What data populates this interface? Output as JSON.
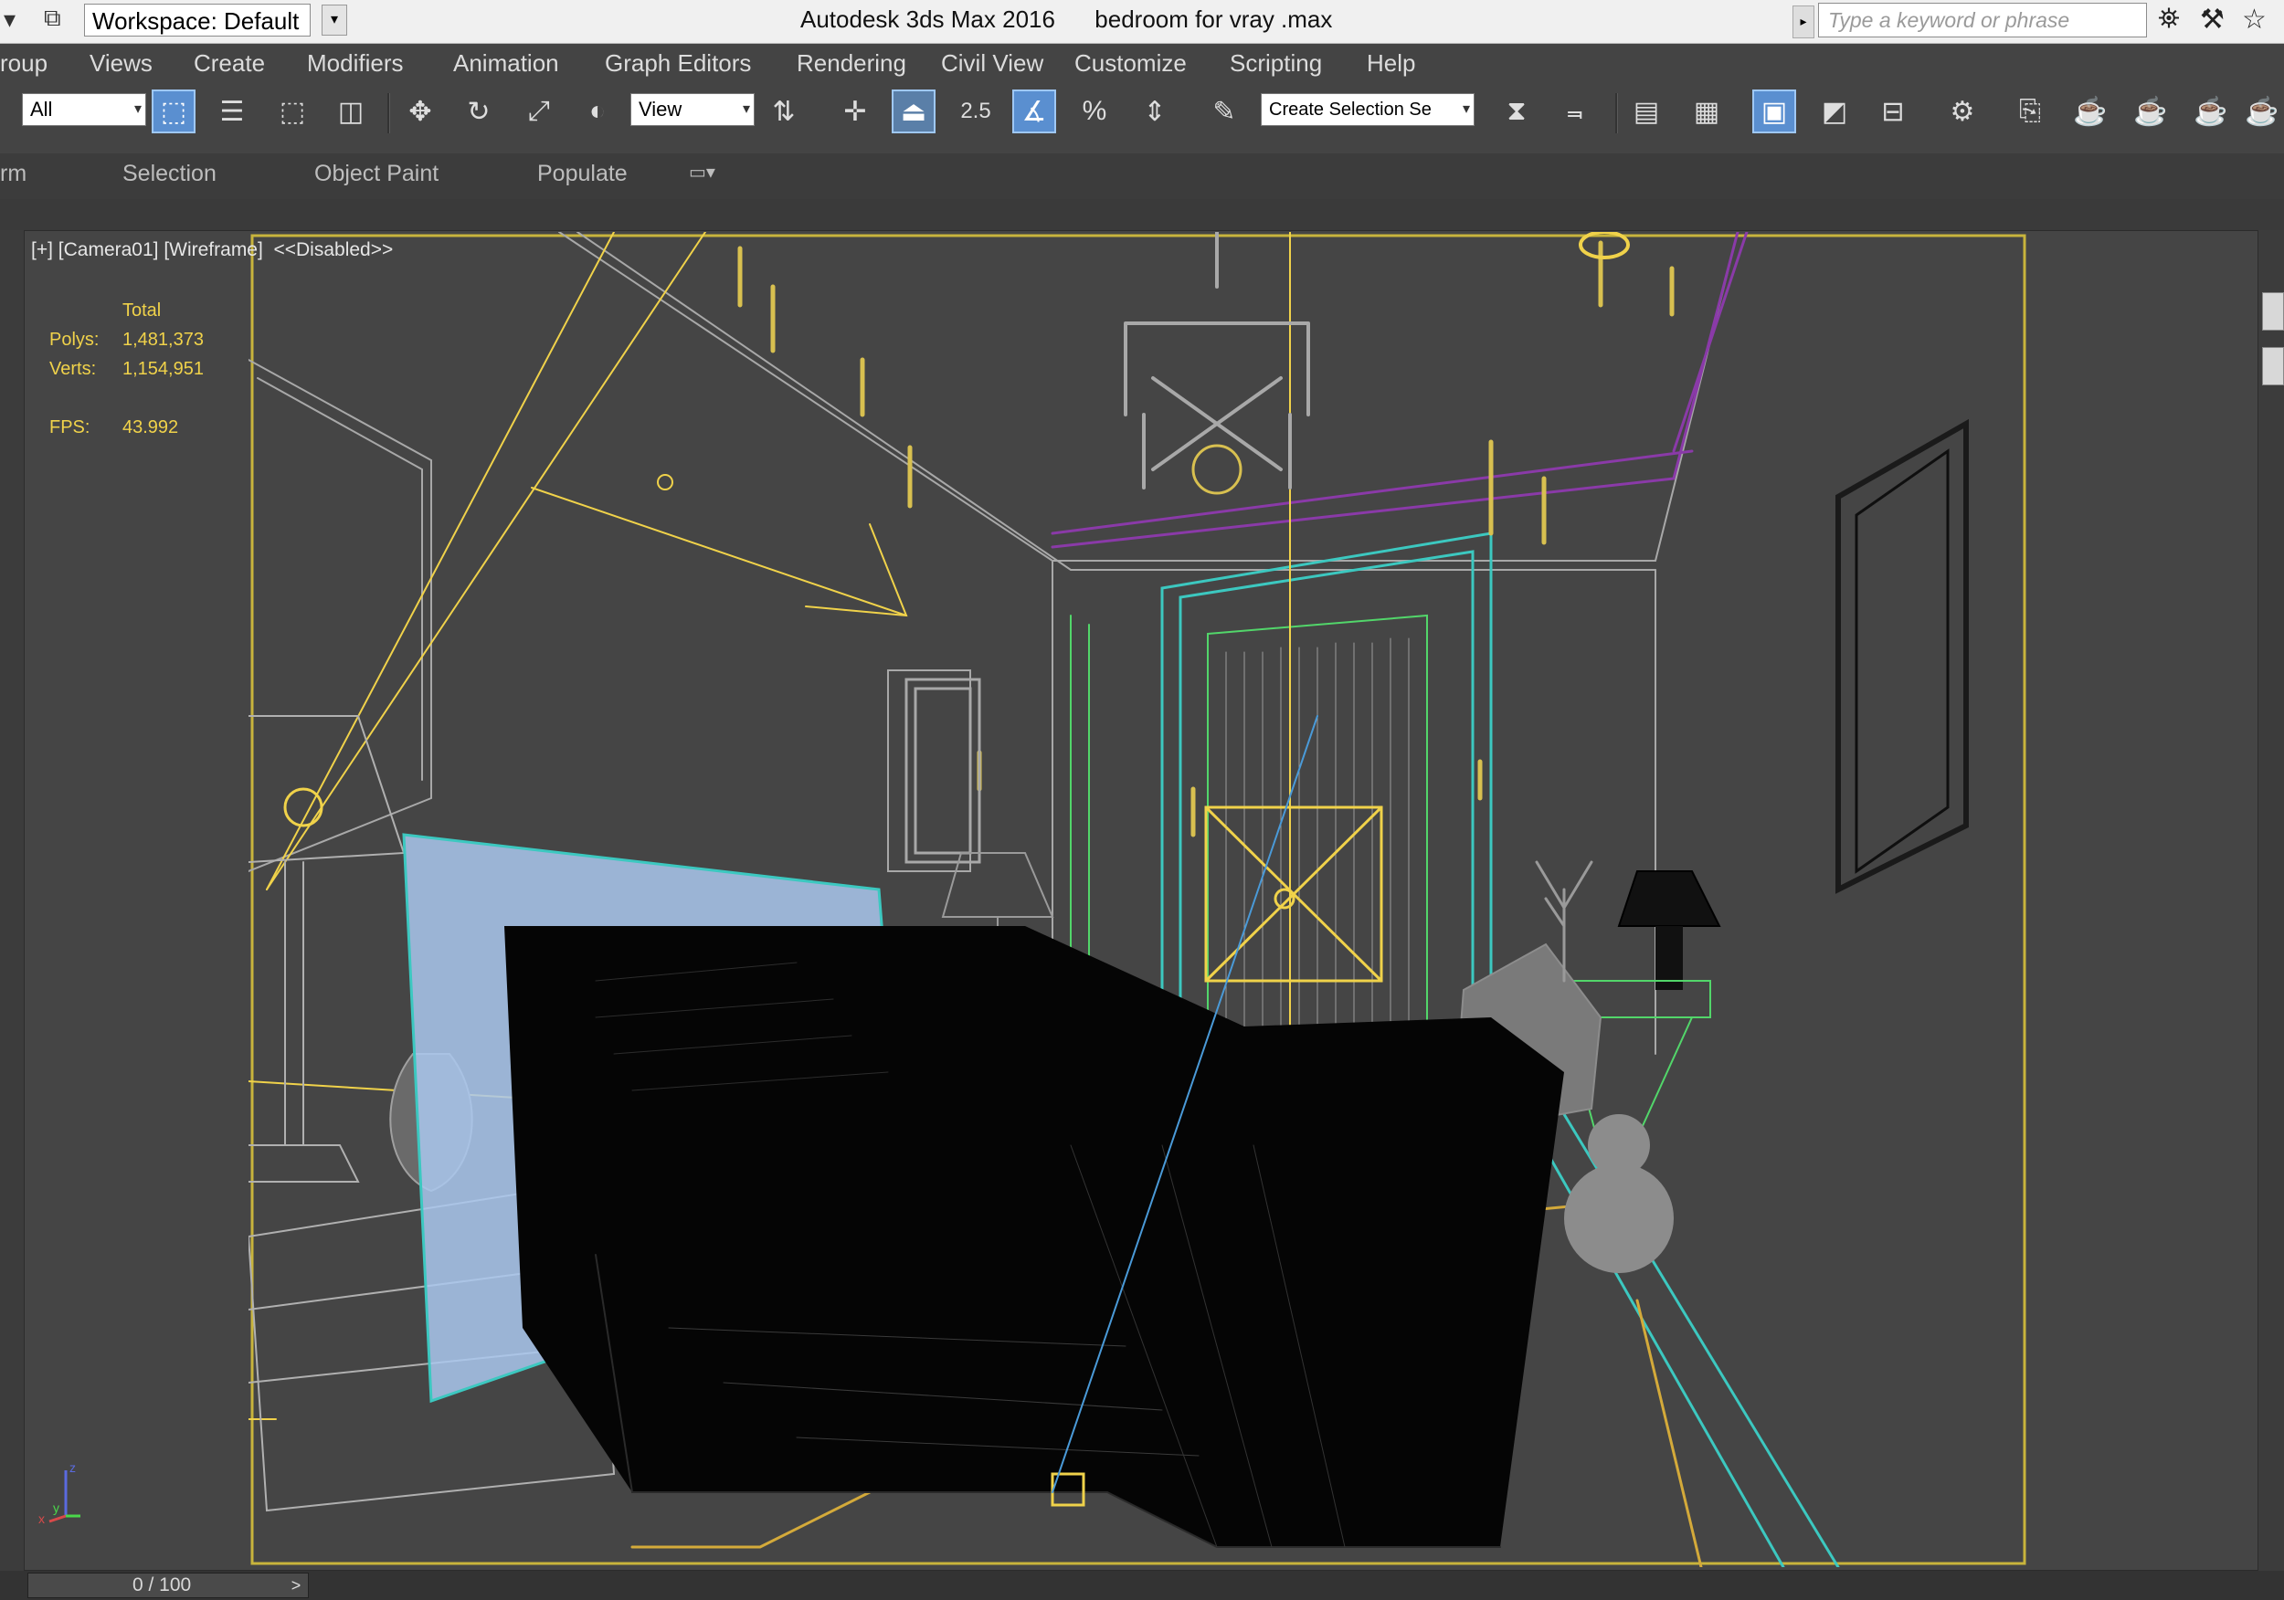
{
  "window": {
    "title": "Autodesk 3ds Max 2016      bedroom for vray .max",
    "workspace": "Workspace: Default",
    "search_placeholder": "Type a keyword or phrase"
  },
  "menu": [
    "roup",
    "Views",
    "Create",
    "Modifiers",
    "Animation",
    "Graph Editors",
    "Rendering",
    "Civil View",
    "Customize",
    "Scripting",
    "Help"
  ],
  "toolbar": {
    "selection_filter": "All",
    "reference_coord": "View",
    "snap_angle": "2.5",
    "named_selection": "Create Selection Se"
  },
  "ribbon": [
    "rm",
    "Selection",
    "Object Paint",
    "Populate"
  ],
  "viewport": {
    "label": "[+] [Camera01] [Wireframe]  <<Disabled>>",
    "stats": {
      "header": "Total",
      "polys_label": "Polys:",
      "polys_value": "1,481,373",
      "verts_label": "Verts:",
      "verts_value": "1,154,951",
      "fps_label": "FPS:",
      "fps_value": "43.992"
    }
  },
  "timeline": {
    "frame": "0 / 100"
  },
  "icons": [
    "system-menu-icon",
    "quick-access-icon",
    "binoculars-icon",
    "tools-icon",
    "star-icon",
    "select-object-icon",
    "select-by-name-icon",
    "rect-region-icon",
    "window-crossing-icon",
    "move-icon",
    "rotate-icon",
    "scale-icon",
    "pivot-icon",
    "manipulate-icon",
    "keyboard-shortcut-icon",
    "snap-toggle-icon",
    "angle-snap-icon",
    "percent-snap-icon",
    "spinner-snap-icon",
    "edit-named-selection-icon",
    "mirror-icon",
    "align-icon",
    "layer-explorer-icon",
    "ribbon-toggle-icon",
    "curve-editor-icon",
    "schematic-view-icon",
    "material-editor-icon",
    "render-setup-icon",
    "rendered-frame-icon",
    "render-production-icon",
    "render-iterative-icon",
    "render-cloud-icon"
  ],
  "colors": {
    "ui_background": "#444444",
    "viewport_background": "#454545",
    "stats_text": "#f0d24a",
    "active_button": "#5a8fd0",
    "safe_frame": "#c8b43c",
    "wire_gray": "#a8a8a8",
    "wire_blue": "#aac8ee",
    "wire_cyan": "#3cc8c0",
    "wire_green": "#52d66a",
    "wire_purple": "#8a3aa8",
    "wire_yellow": "#f0d24a"
  }
}
